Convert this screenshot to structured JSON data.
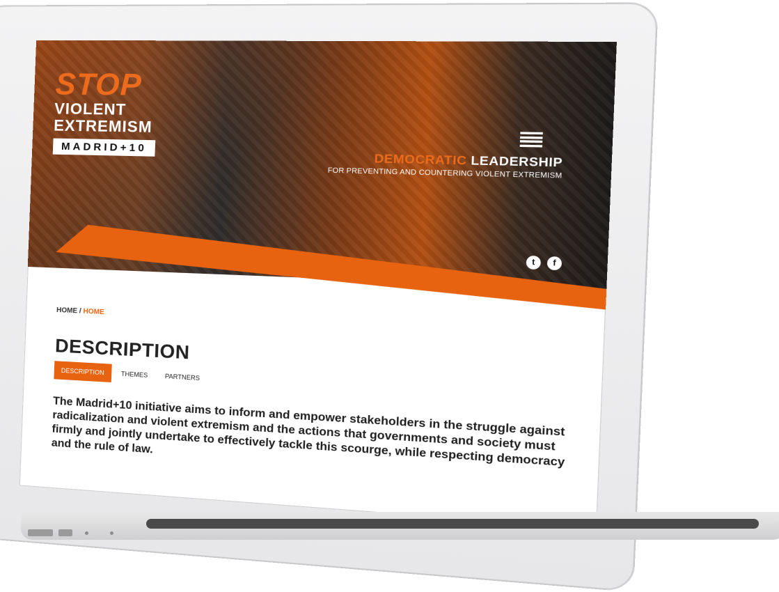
{
  "logo": {
    "stop": "STOP",
    "line1": "VIOLENT",
    "line2": "EXTREMISM",
    "badge": "MADRID+10"
  },
  "tagline": {
    "title_part1": "DEMOCRATIC",
    "title_part2": "LEADERSHIP",
    "subtitle": "FOR PREVENTING AND COUNTERING VIOLENT EXTREMISM"
  },
  "social": {
    "twitter": "t",
    "facebook": "f"
  },
  "breadcrumb": {
    "home": "HOME /",
    "current": "HOME"
  },
  "page": {
    "title": "DESCRIPTION",
    "tabs": [
      "DESCRIPTION",
      "THEMES",
      "PARTNERS"
    ],
    "active_tab": "DESCRIPTION",
    "description": "The Madrid+10 initiative aims to inform and empower stakeholders in the struggle against radicalization and violent extremism and the actions that governments and society must firmly and jointly undertake to effectively tackle this scourge, while respecting democracy and the rule of law."
  },
  "colors": {
    "accent": "#e8630f",
    "dark": "#1e1e1e"
  }
}
